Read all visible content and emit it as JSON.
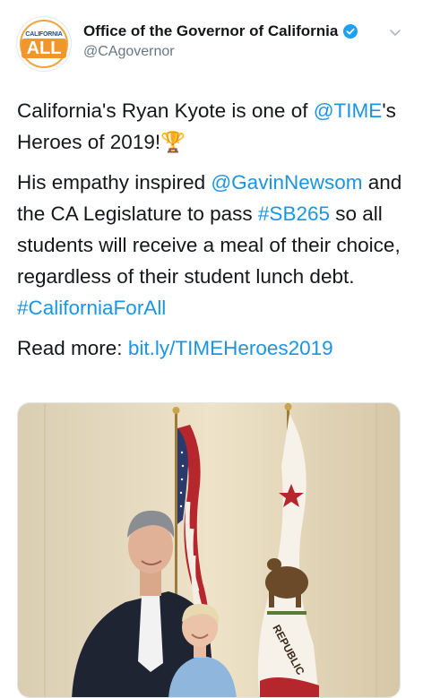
{
  "tweet": {
    "display_name": "Office of the Governor of California",
    "handle": "@CAgovernor",
    "avatar": {
      "top_text": "CALIFORNIA",
      "main_text": "ALL",
      "icon": "california-for-all-logo"
    },
    "verified_icon": "verified-badge-icon",
    "menu_icon": "chevron-down-icon",
    "paragraphs": [
      {
        "segments": [
          {
            "text": "California's Ryan Kyote is one of ",
            "link": false
          },
          {
            "text": "@TIME",
            "link": true
          },
          {
            "text": "'s Heroes of 2019!",
            "link": false
          },
          {
            "text": "🏆",
            "link": false,
            "icon": "trophy-icon"
          }
        ]
      },
      {
        "segments": [
          {
            "text": "His empathy inspired ",
            "link": false
          },
          {
            "text": "@GavinNewsom",
            "link": true
          },
          {
            "text": " and the CA Legislature to pass ",
            "link": false
          },
          {
            "text": "#SB265",
            "link": true
          },
          {
            "text": " so all students will receive a meal of their choice, regardless of their student lunch debt. ",
            "link": false
          },
          {
            "text": "#CaliforniaForAll",
            "link": true
          }
        ]
      },
      {
        "segments": [
          {
            "text": "Read more: ",
            "link": false
          },
          {
            "text": "bit.ly/TIMEHeroes2019",
            "link": true
          }
        ]
      }
    ],
    "media": {
      "flag_text": "REPUBLIC",
      "description_icon": "photo-governor-with-student"
    },
    "colors": {
      "link": "#1b95e0",
      "verified": "#1da1f2",
      "text": "#14171a",
      "secondary": "#657786"
    }
  }
}
